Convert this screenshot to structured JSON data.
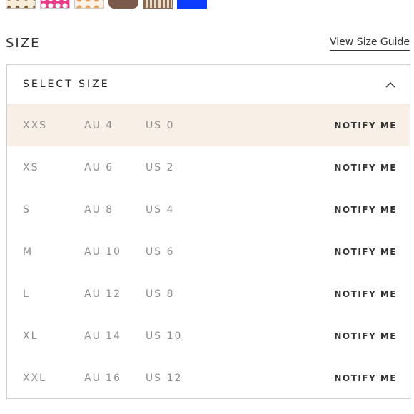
{
  "swatches": [
    {
      "name": "swatch-cream-dots"
    },
    {
      "name": "swatch-pink-floral"
    },
    {
      "name": "swatch-cream-floral"
    },
    {
      "name": "swatch-brown"
    },
    {
      "name": "swatch-brown-stripe"
    },
    {
      "name": "swatch-blue"
    }
  ],
  "size_section": {
    "title": "SIZE",
    "guide_link": "View Size Guide"
  },
  "dropdown": {
    "label": "SELECT SIZE",
    "icon": "chevron-up-icon",
    "rows": [
      {
        "size": "XXS",
        "au": "AU 4",
        "us": "US 0",
        "action": "NOTIFY ME"
      },
      {
        "size": "XS",
        "au": "AU 6",
        "us": "US 2",
        "action": "NOTIFY ME"
      },
      {
        "size": "S",
        "au": "AU 8",
        "us": "US 4",
        "action": "NOTIFY ME"
      },
      {
        "size": "M",
        "au": "AU 10",
        "us": "US 6",
        "action": "NOTIFY ME"
      },
      {
        "size": "L",
        "au": "AU 12",
        "us": "US 8",
        "action": "NOTIFY ME"
      },
      {
        "size": "XL",
        "au": "AU 14",
        "us": "US 10",
        "action": "NOTIFY ME"
      },
      {
        "size": "XXL",
        "au": "AU 16",
        "us": "US 12",
        "action": "NOTIFY ME"
      }
    ]
  },
  "colors": {
    "highlight_row": "#f8efe6",
    "border": "#cfcfcf",
    "muted_text": "#8e8e8e"
  }
}
